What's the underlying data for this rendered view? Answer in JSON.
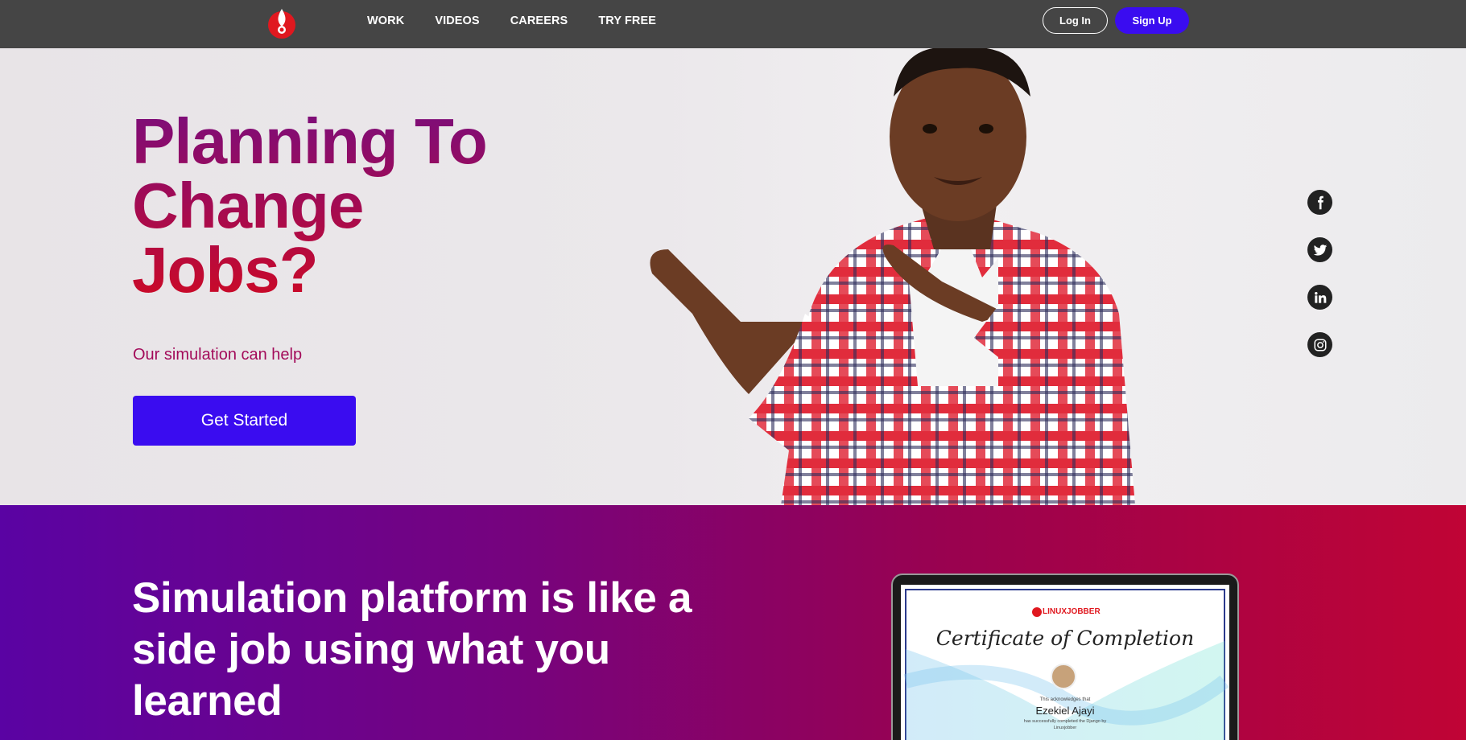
{
  "nav": {
    "links": [
      "WORK",
      "VIDEOS",
      "CAREERS",
      "TRY FREE"
    ],
    "login": "Log In",
    "signup": "Sign Up"
  },
  "hero": {
    "title_lines": [
      "Planning To",
      "Change",
      "Jobs?"
    ],
    "subtitle": "Our simulation can help",
    "cta": "Get Started"
  },
  "social": [
    "facebook-icon",
    "twitter-icon",
    "linkedin-icon",
    "instagram-icon"
  ],
  "band": {
    "heading": "Simulation platform is like a side job using what you learned"
  },
  "certificate": {
    "brand": "LINUXJOBBER",
    "title": "Certificate of Completion",
    "acknowledges": "This acknowledges that",
    "name": "Ezekiel Ajayi",
    "completed": "has successfully completed the Django by",
    "issuer": "Linuxjobber"
  },
  "colors": {
    "accent": "#3a0cf0",
    "topbar": "#454545",
    "hero_text": "#a30b5a"
  }
}
